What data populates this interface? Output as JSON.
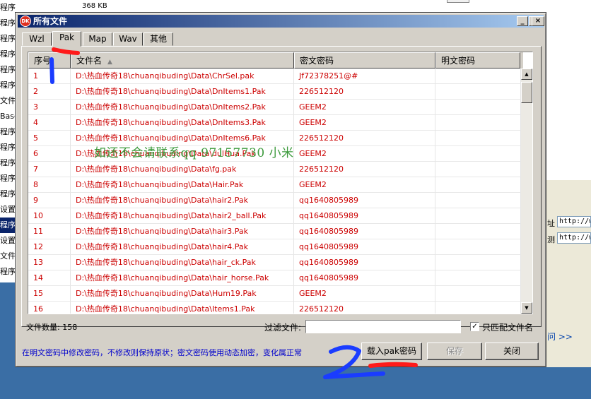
{
  "background": {
    "left_rows": [
      {
        "text": "程序扩展",
        "size": "368 KB"
      },
      {
        "text": "程序扩"
      },
      {
        "text": "程序扩"
      },
      {
        "text": "程序扩"
      },
      {
        "text": "程序扩"
      },
      {
        "text": "程序扩"
      },
      {
        "text": "文件"
      },
      {
        "text": "Base"
      },
      {
        "text": "程序扩"
      },
      {
        "text": "程序扩"
      },
      {
        "text": "程序扩"
      },
      {
        "text": "程序扩"
      },
      {
        "text": "程序"
      },
      {
        "text": "设置"
      },
      {
        "text": "程序扩",
        "selected": true
      },
      {
        "text": "设置"
      },
      {
        "text": "文件"
      },
      {
        "text": "程序扩"
      }
    ],
    "right_fields": [
      {
        "label": "址",
        "value": "http://w"
      },
      {
        "label": "测",
        "value": "http://w"
      }
    ],
    "right_link": "问 >>"
  },
  "dialog": {
    "title": "所有文件",
    "app_icon_text": "DK",
    "window_buttons": {
      "minimize": "_",
      "maximize": "□",
      "close": "×"
    },
    "tabs": [
      {
        "label": "Wzl",
        "active": false
      },
      {
        "label": "Pak",
        "active": true
      },
      {
        "label": "Map",
        "active": false
      },
      {
        "label": "Wav",
        "active": false
      },
      {
        "label": "其他",
        "active": false
      }
    ],
    "columns": [
      "序号",
      "文件名",
      "密文密码",
      "明文密码"
    ],
    "sort_indicator": "▲",
    "rows": [
      {
        "no": "1",
        "file": "D:\\热血传奇18\\chuanqibuding\\Data\\ChrSel.pak",
        "cipher": "Jf72378251@#",
        "plain": ""
      },
      {
        "no": "2",
        "file": "D:\\热血传奇18\\chuanqibuding\\Data\\DnItems1.Pak",
        "cipher": "226512120",
        "plain": ""
      },
      {
        "no": "3",
        "file": "D:\\热血传奇18\\chuanqibuding\\Data\\DnItems2.Pak",
        "cipher": "GEEM2",
        "plain": ""
      },
      {
        "no": "4",
        "file": "D:\\热血传奇18\\chuanqibuding\\Data\\DnItems3.Pak",
        "cipher": "GEEM2",
        "plain": ""
      },
      {
        "no": "5",
        "file": "D:\\热血传奇18\\chuanqibuding\\Data\\DnItems6.Pak",
        "cipher": "226512120",
        "plain": ""
      },
      {
        "no": "6",
        "file": "D:\\热血传奇18\\chuanqibuding\\Data\\dulHua.Pak",
        "cipher": "GEEM2",
        "plain": ""
      },
      {
        "no": "7",
        "file": "D:\\热血传奇18\\chuanqibuding\\Data\\fg.pak",
        "cipher": "226512120",
        "plain": ""
      },
      {
        "no": "8",
        "file": "D:\\热血传奇18\\chuanqibuding\\Data\\Hair.Pak",
        "cipher": "GEEM2",
        "plain": ""
      },
      {
        "no": "9",
        "file": "D:\\热血传奇18\\chuanqibuding\\Data\\hair2.Pak",
        "cipher": "qq1640805989",
        "plain": ""
      },
      {
        "no": "10",
        "file": "D:\\热血传奇18\\chuanqibuding\\Data\\hair2_ball.Pak",
        "cipher": "qq1640805989",
        "plain": ""
      },
      {
        "no": "11",
        "file": "D:\\热血传奇18\\chuanqibuding\\Data\\hair3.Pak",
        "cipher": "qq1640805989",
        "plain": ""
      },
      {
        "no": "12",
        "file": "D:\\热血传奇18\\chuanqibuding\\Data\\hair4.Pak",
        "cipher": "qq1640805989",
        "plain": ""
      },
      {
        "no": "13",
        "file": "D:\\热血传奇18\\chuanqibuding\\Data\\hair_ck.Pak",
        "cipher": "qq1640805989",
        "plain": ""
      },
      {
        "no": "14",
        "file": "D:\\热血传奇18\\chuanqibuding\\Data\\hair_horse.Pak",
        "cipher": "qq1640805989",
        "plain": ""
      },
      {
        "no": "15",
        "file": "D:\\热血传奇18\\chuanqibuding\\Data\\Hum19.Pak",
        "cipher": "GEEM2",
        "plain": ""
      },
      {
        "no": "16",
        "file": "D:\\热血传奇18\\chuanqibuding\\Data\\Items1.Pak",
        "cipher": "226512120",
        "plain": ""
      }
    ],
    "watermark": "如还不会请联系qq  97157730  小米",
    "file_count_label": "文件数量: 158",
    "filter_label": "过滤文件:",
    "filter_value": "",
    "match_filename_label": "只匹配文件名",
    "match_filename_checked": "✓",
    "hint": "在明文密码中修改密码，不修改则保持原状；密文密码使用动态加密，变化属正常",
    "buttons": {
      "load": "载入pak密码",
      "save": "保存",
      "close": "关闭"
    }
  },
  "colors": {
    "row_text": "#cc0000",
    "hint_text": "#0000cc",
    "watermark": "#3c9a3c",
    "title_gradient_start": "#0a246a",
    "scribble_red": "#ff1a1a",
    "scribble_blue": "#1a3cff"
  }
}
